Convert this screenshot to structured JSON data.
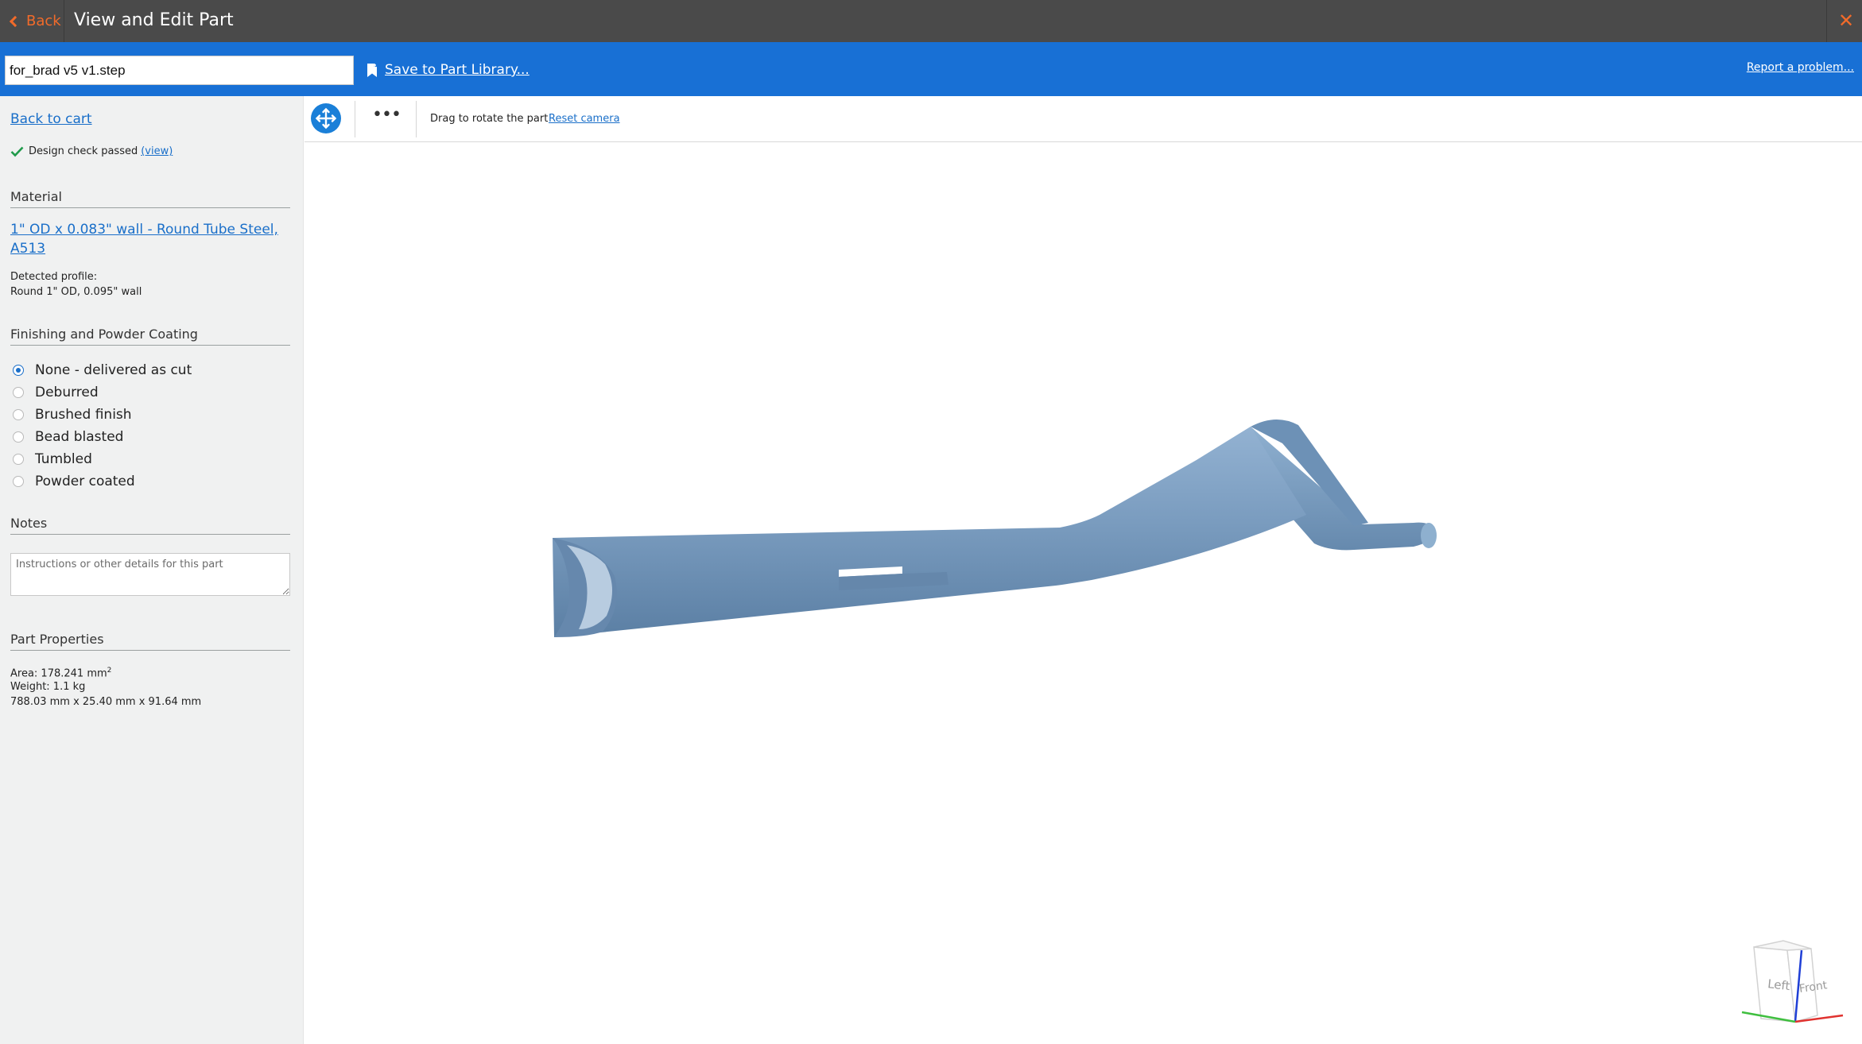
{
  "titlebar": {
    "back_label": "Back",
    "title": "View and Edit Part",
    "close_glyph": "✕"
  },
  "filebar": {
    "filename": "for_brad v5 v1.step",
    "save_label": "Save to Part Library...",
    "report_label": "Report a problem..."
  },
  "sidebar": {
    "back_to_cart": "Back to cart",
    "design_check": "Design check passed",
    "design_check_view": "(view)",
    "material_heading": "Material",
    "material_link": "1\" OD x 0.083\" wall - Round Tube Steel, A513",
    "detected_label": "Detected profile:",
    "detected_value": "Round 1\" OD, 0.095\" wall",
    "finishing_heading": "Finishing and Powder Coating",
    "finishing_options": [
      {
        "label": "None - delivered as cut",
        "checked": true
      },
      {
        "label": "Deburred",
        "checked": false
      },
      {
        "label": "Brushed finish",
        "checked": false
      },
      {
        "label": "Bead blasted",
        "checked": false
      },
      {
        "label": "Tumbled",
        "checked": false
      },
      {
        "label": "Powder coated",
        "checked": false
      }
    ],
    "notes_heading": "Notes",
    "notes_placeholder": "Instructions or other details for this part",
    "properties_heading": "Part Properties",
    "area_label": "Area: 178.241 mm",
    "area_sup": "2",
    "weight": "Weight: 1.1 kg",
    "dimensions": "788.03 mm x 25.40 mm x 91.64 mm"
  },
  "viewer": {
    "more_glyph": "•••",
    "drag_hint": "Drag to rotate the part",
    "reset_camera": "Reset camera",
    "cube_left": "Left",
    "cube_front": "Front"
  },
  "colors": {
    "titlebar": "#4a4a4a",
    "accent_orange": "#f26b2a",
    "bluebar": "#1870d5",
    "link_blue": "#1a6fc9",
    "part_color": "#7a9cbf",
    "sidebar_bg": "#f0f1f1"
  },
  "icons": {
    "back": "chevron-left-icon",
    "close": "close-icon",
    "save": "bookmark-plus-icon",
    "check": "checkmark-icon",
    "move": "move-arrows-icon",
    "more": "ellipsis-icon",
    "orientation": "view-cube-icon"
  }
}
